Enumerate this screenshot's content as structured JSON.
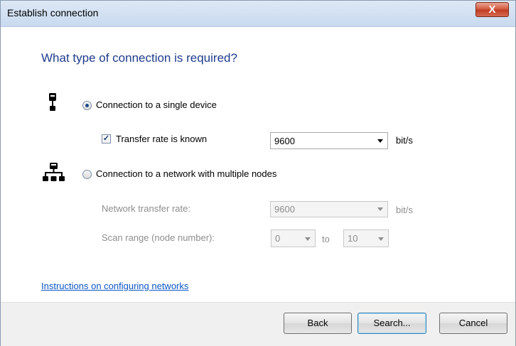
{
  "window": {
    "title": "Establish connection",
    "close_glyph": "X"
  },
  "heading": "What type of connection is required?",
  "single": {
    "label": "Connection to a single device",
    "selected": true,
    "icon": "single-device-icon",
    "transfer_known_label": "Transfer rate is known",
    "transfer_known_checked": true,
    "checkmark": "✓",
    "rate_value": "9600",
    "rate_unit": "bit/s"
  },
  "network": {
    "label": "Connection to a network with multiple nodes",
    "selected": false,
    "icon": "network-icon",
    "rate_label": "Network transfer rate:",
    "rate_value": "9600",
    "rate_unit": "bit/s",
    "scan_label": "Scan range (node number):",
    "scan_from": "0",
    "scan_to_label": "to",
    "scan_to": "10"
  },
  "link": "Instructions on configuring networks",
  "buttons": {
    "back": "Back",
    "search": "Search...",
    "cancel": "Cancel"
  }
}
